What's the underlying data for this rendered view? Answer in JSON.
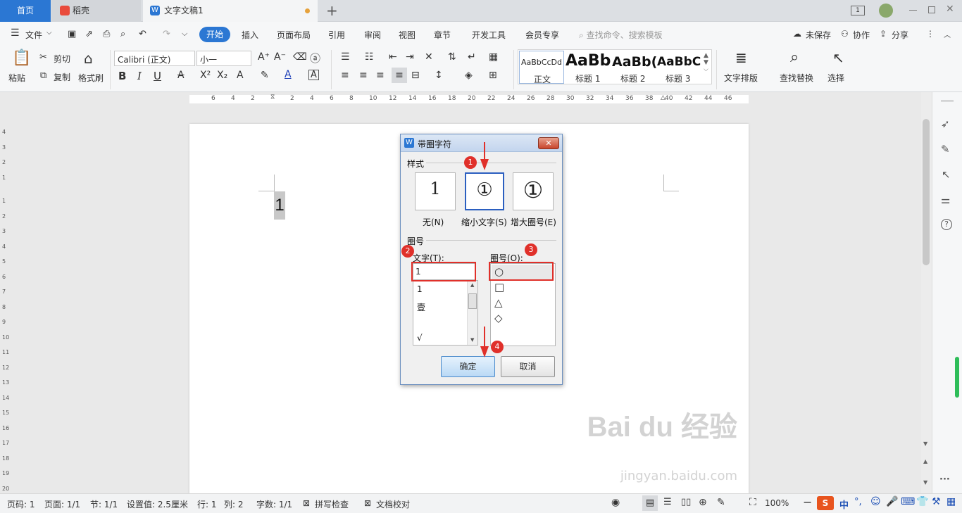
{
  "tabs": {
    "home": "首页",
    "daoke": "稻壳",
    "doc": "文字文稿1",
    "add": "+"
  },
  "menu": {
    "file": "文件",
    "items": [
      "开始",
      "插入",
      "页面布局",
      "引用",
      "审阅",
      "视图",
      "章节",
      "开发工具",
      "会员专享"
    ],
    "search_placeholder": "查找命令、搜索模板",
    "unsaved": "未保存",
    "collab": "协作",
    "share": "分享"
  },
  "ribbon": {
    "paste": "粘贴",
    "cut": "剪切",
    "copy": "复制",
    "format_painter": "格式刷",
    "font_name": "Calibri (正文)",
    "font_size": "小一",
    "styles": [
      {
        "preview": "AaBbCcDd",
        "name": "正文"
      },
      {
        "preview": "AaBb",
        "name": "标题 1"
      },
      {
        "preview": "AaBb(",
        "name": "标题 2"
      },
      {
        "preview": "AaBbC",
        "name": "标题 3"
      }
    ],
    "text_layout": "文字排版",
    "find_replace": "查找替换",
    "select": "选择"
  },
  "ruler": {
    "h_ticks": [
      "6",
      "4",
      "2",
      "2",
      "4",
      "6",
      "8",
      "10",
      "12",
      "14",
      "16",
      "18",
      "20",
      "22",
      "24",
      "26",
      "28",
      "30",
      "32",
      "34",
      "36",
      "38",
      "40",
      "42",
      "44",
      "46"
    ],
    "v_ticks": [
      "4",
      "3",
      "2",
      "1",
      "1",
      "2",
      "3",
      "4",
      "5",
      "6",
      "7",
      "8",
      "9",
      "10",
      "11",
      "12",
      "13",
      "14",
      "15",
      "16",
      "17",
      "18",
      "19",
      "20"
    ]
  },
  "document": {
    "text": "1"
  },
  "dialog": {
    "title": "带圈字符",
    "style_group": "样式",
    "styles": [
      {
        "glyph": "1",
        "label": "无(N)"
      },
      {
        "glyph": "①",
        "label": "缩小文字(S)"
      },
      {
        "glyph": "①",
        "label": "增大圈号(E)"
      }
    ],
    "circle_group": "圈号",
    "text_label": "文字(T):",
    "text_value": "1",
    "text_options": [
      "1",
      "壹",
      "√"
    ],
    "enclosure_label": "圈号(O):",
    "enclosure_options": [
      "○",
      "□",
      "△",
      "◇"
    ],
    "ok": "确定",
    "cancel": "取消",
    "badges": [
      "1",
      "2",
      "3",
      "4"
    ]
  },
  "status": {
    "page_code": "页码: 1",
    "pages": "页面: 1/1",
    "section": "节: 1/1",
    "setting": "设置值: 2.5厘米",
    "row": "行: 1",
    "col": "列: 2",
    "words": "字数: 1/1",
    "spell": "拼写检查",
    "proof": "文档校对",
    "zoom": "100%",
    "ime": "中"
  },
  "watermark": "Bai du 经验",
  "watermark_url": "jingyan.baidu.com",
  "colors": {
    "accent": "#2b77d3",
    "highlight": "#e0302a"
  }
}
